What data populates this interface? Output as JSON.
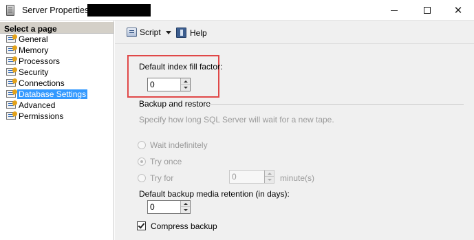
{
  "window": {
    "title": "Server Properties -",
    "minimize_icon": "minimize-icon",
    "maximize_icon": "maximize-icon",
    "close_icon": "close-icon",
    "close_glyph": "✕"
  },
  "nav": {
    "header": "Select a page",
    "items": [
      {
        "label": "General",
        "selected": false
      },
      {
        "label": "Memory",
        "selected": false
      },
      {
        "label": "Processors",
        "selected": false
      },
      {
        "label": "Security",
        "selected": false
      },
      {
        "label": "Connections",
        "selected": false
      },
      {
        "label": "Database Settings",
        "selected": true
      },
      {
        "label": "Advanced",
        "selected": false
      },
      {
        "label": "Permissions",
        "selected": false
      }
    ],
    "selected_color": "#3399ff"
  },
  "toolbar": {
    "script_label": "Script",
    "help_label": "Help"
  },
  "settings": {
    "fill_factor_label": "Default index fill factor:",
    "fill_factor_value": "0",
    "backup_group_label": "Backup and restore",
    "backup_description": "Specify how long SQL Server will wait for a new tape.",
    "wait_indefinitely_label": "Wait indefinitely",
    "try_once_label": "Try once",
    "try_for_label": "Try for",
    "try_for_value": "0",
    "minutes_label": "minute(s)",
    "retention_label": "Default backup media retention (in days):",
    "retention_value": "0",
    "compress_backup_label": "Compress backup",
    "compress_backup_checked": true,
    "selected_radio": "Try once"
  },
  "colors": {
    "highlight_border": "#e04848",
    "panel_background": "#f0f0f0"
  }
}
